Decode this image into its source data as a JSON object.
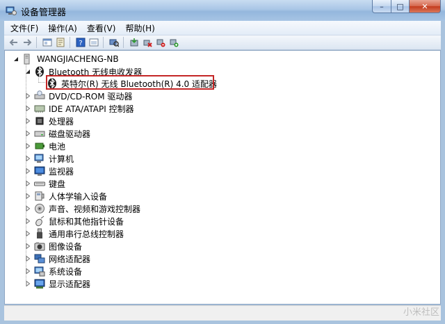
{
  "window": {
    "title": "设备管理器",
    "controls": {
      "minimize": "–",
      "maximize": "□",
      "close": "✕"
    }
  },
  "menu": [
    {
      "label": "文件(F)"
    },
    {
      "label": "操作(A)"
    },
    {
      "label": "查看(V)"
    },
    {
      "label": "帮助(H)"
    }
  ],
  "toolbar": [
    {
      "icon": "back-arrow-icon"
    },
    {
      "icon": "forward-arrow-icon"
    },
    {
      "icon": "properties-window-icon"
    },
    {
      "icon": "tree-view-icon"
    },
    {
      "icon": "help-icon"
    },
    {
      "icon": "show-hidden-icon"
    },
    {
      "icon": "scan-hardware-icon"
    },
    {
      "icon": "update-driver-icon"
    },
    {
      "icon": "uninstall-icon"
    },
    {
      "icon": "disable-device-icon"
    },
    {
      "icon": "enable-device-icon"
    }
  ],
  "tree": {
    "root": {
      "label": "WANGJIACHENG-NB",
      "icon": "computer-icon"
    },
    "bluetooth": {
      "label": "Bluetooth 无线电收发器",
      "icon": "bluetooth-icon",
      "child": "英特尔(R) 无线 Bluetooth(R) 4.0 适配器"
    },
    "categories": [
      {
        "label": "DVD/CD-ROM 驱动器",
        "icon": "dvd-drive-icon"
      },
      {
        "label": "IDE ATA/ATAPI 控制器",
        "icon": "ide-controller-icon"
      },
      {
        "label": "处理器",
        "icon": "processor-icon"
      },
      {
        "label": "磁盘驱动器",
        "icon": "disk-drive-icon"
      },
      {
        "label": "电池",
        "icon": "battery-icon"
      },
      {
        "label": "计算机",
        "icon": "computer-icon"
      },
      {
        "label": "监视器",
        "icon": "monitor-icon"
      },
      {
        "label": "键盘",
        "icon": "keyboard-icon"
      },
      {
        "label": "人体学输入设备",
        "icon": "hid-icon"
      },
      {
        "label": "声音、视频和游戏控制器",
        "icon": "sound-icon"
      },
      {
        "label": "鼠标和其他指针设备",
        "icon": "mouse-icon"
      },
      {
        "label": "通用串行总线控制器",
        "icon": "usb-icon"
      },
      {
        "label": "图像设备",
        "icon": "camera-icon"
      },
      {
        "label": "网络适配器",
        "icon": "network-adapter-icon"
      },
      {
        "label": "系统设备",
        "icon": "system-device-icon"
      },
      {
        "label": "显示适配器",
        "icon": "display-adapter-icon"
      }
    ]
  },
  "watermark": "小米社区"
}
